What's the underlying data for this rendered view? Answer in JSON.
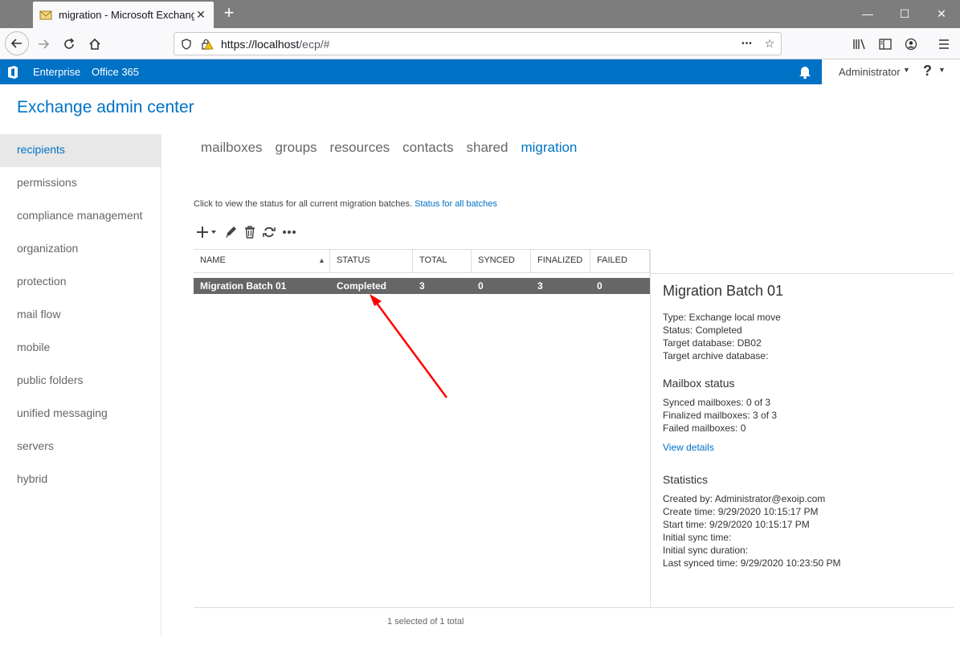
{
  "browser": {
    "tab_title": "migration - Microsoft Exchange",
    "new_tab": "+",
    "url_host": "https://localhost",
    "url_rest": "/ecp/#",
    "more_actions": "•••"
  },
  "topbar": {
    "enterprise": "Enterprise",
    "office365": "Office 365",
    "user": "Administrator",
    "help": "?"
  },
  "app": {
    "title": "Exchange admin center"
  },
  "leftnav": {
    "items": [
      {
        "label": "recipients"
      },
      {
        "label": "permissions"
      },
      {
        "label": "compliance management"
      },
      {
        "label": "organization"
      },
      {
        "label": "protection"
      },
      {
        "label": "mail flow"
      },
      {
        "label": "mobile"
      },
      {
        "label": "public folders"
      },
      {
        "label": "unified messaging"
      },
      {
        "label": "servers"
      },
      {
        "label": "hybrid"
      }
    ]
  },
  "subtabs": {
    "items": [
      {
        "label": "mailboxes"
      },
      {
        "label": "groups"
      },
      {
        "label": "resources"
      },
      {
        "label": "contacts"
      },
      {
        "label": "shared"
      },
      {
        "label": "migration"
      }
    ]
  },
  "info": {
    "text": "Click to view the status for all current migration batches.",
    "link": "Status for all batches"
  },
  "table": {
    "headers": {
      "name": "NAME",
      "status": "STATUS",
      "total": "TOTAL",
      "synced": "SYNCED",
      "finalized": "FINALIZED",
      "failed": "FAILED"
    },
    "rows": [
      {
        "name": "Migration Batch 01",
        "status": "Completed",
        "total": "3",
        "synced": "0",
        "finalized": "3",
        "failed": "0"
      }
    ],
    "footer": "1 selected of 1 total"
  },
  "details": {
    "title": "Migration Batch 01",
    "type": "Type: Exchange local move",
    "status": "Status: Completed",
    "target_db": "Target database: DB02",
    "target_archive": "Target archive database:",
    "mailbox_status_heading": "Mailbox status",
    "synced": "Synced mailboxes: 0 of 3",
    "finalized": "Finalized mailboxes: 3 of 3",
    "failed": "Failed mailboxes: 0",
    "view_details": "View details",
    "statistics_heading": "Statistics",
    "created_by": "Created by: Administrator@exoip.com",
    "create_time": "Create time: 9/29/2020 10:15:17 PM",
    "start_time": "Start time: 9/29/2020 10:15:17 PM",
    "initial_sync_time": "Initial sync time:",
    "initial_sync_duration": "Initial sync duration:",
    "last_synced": "Last synced time: 9/29/2020 10:23:50 PM"
  },
  "colors": {
    "office_blue": "#0072c6",
    "selected_row": "#666666",
    "annotation_red": "#ff0000"
  }
}
